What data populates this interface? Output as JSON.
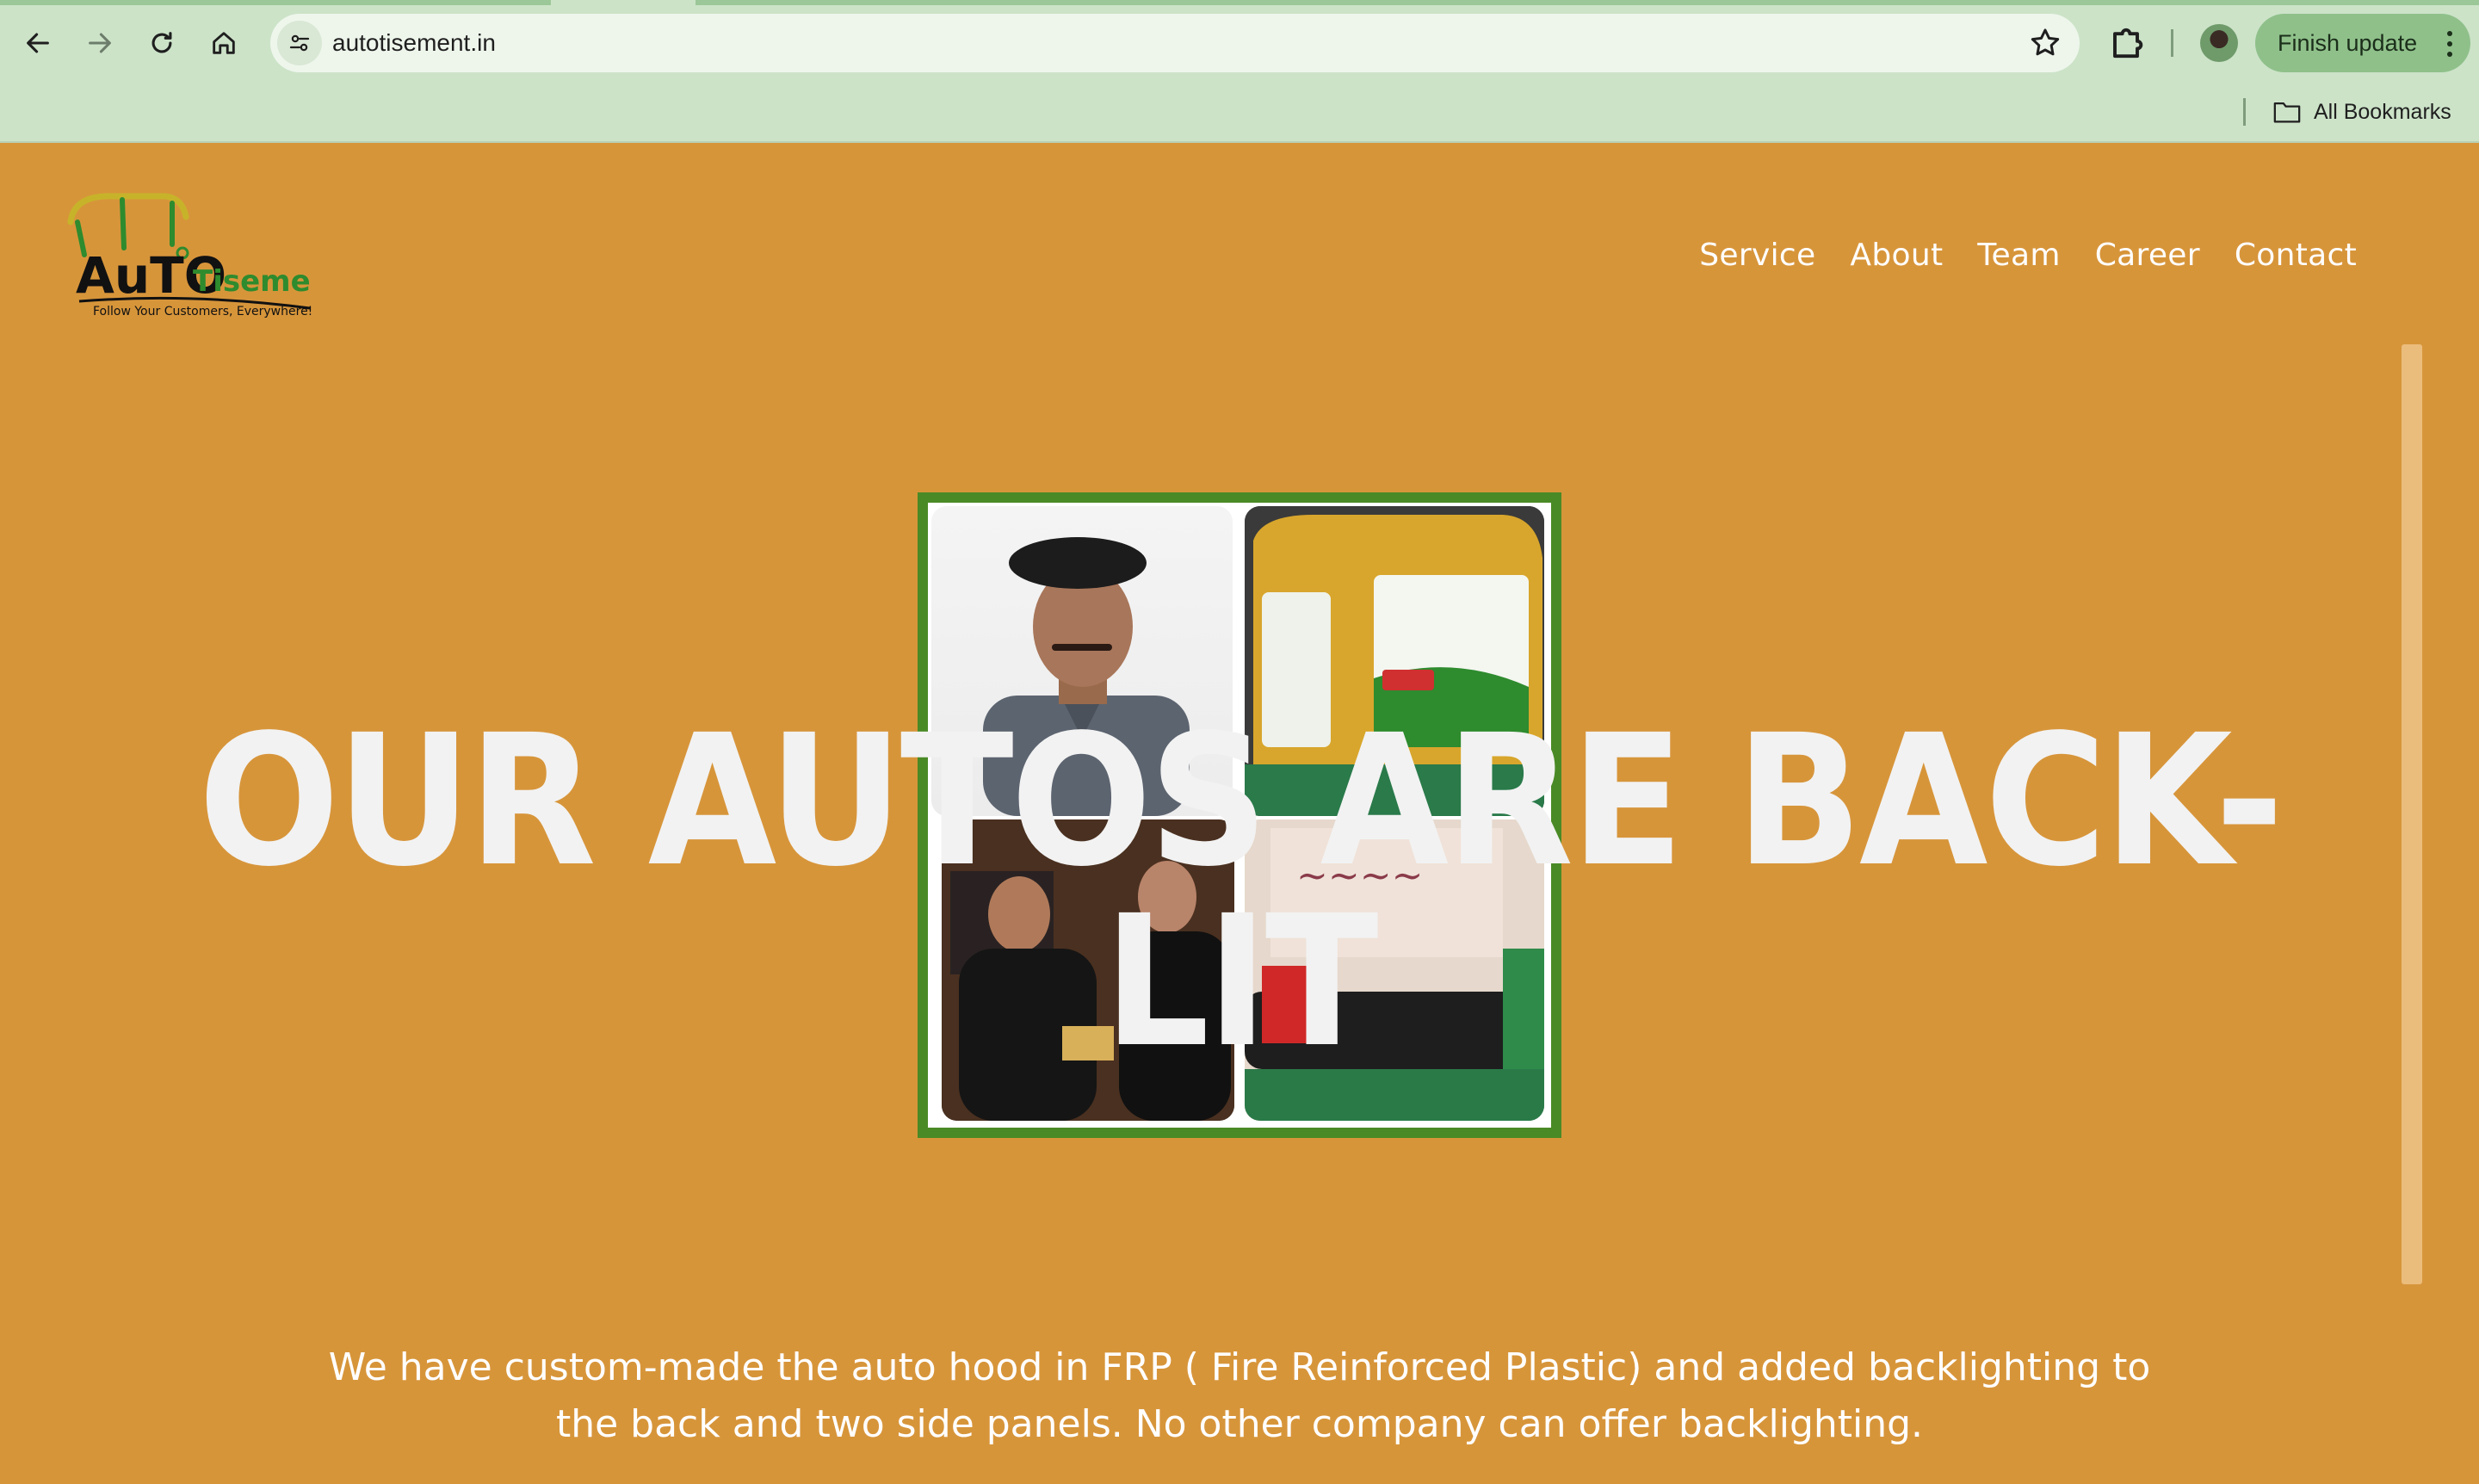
{
  "browser": {
    "url": "autotisement.in",
    "finish_update_label": "Finish update",
    "all_bookmarks_label": "All Bookmarks"
  },
  "site": {
    "logo": {
      "wordmark_primary": "AuTO",
      "wordmark_secondary": "Tisement",
      "tagline": "Follow Your Customers, Everywhere!",
      "colors": {
        "primary": "#111111",
        "secondary": "#2e8b2e",
        "accent": "#c7b32a"
      }
    },
    "nav": [
      {
        "label": "Service"
      },
      {
        "label": "About"
      },
      {
        "label": "Team"
      },
      {
        "label": "Career"
      },
      {
        "label": "Contact"
      }
    ],
    "hero": {
      "title": "OUR AUTOS ARE BACK-LIT",
      "description": "We have custom-made the auto hood in FRP ( Fire Reinforced Plastic) and added backlighting to the back and two side panels. No other company can offer backlighting."
    },
    "colors": {
      "background": "#d7953a",
      "collage_border": "#4a8a26",
      "scrollbar": "#ebbd7c"
    }
  }
}
